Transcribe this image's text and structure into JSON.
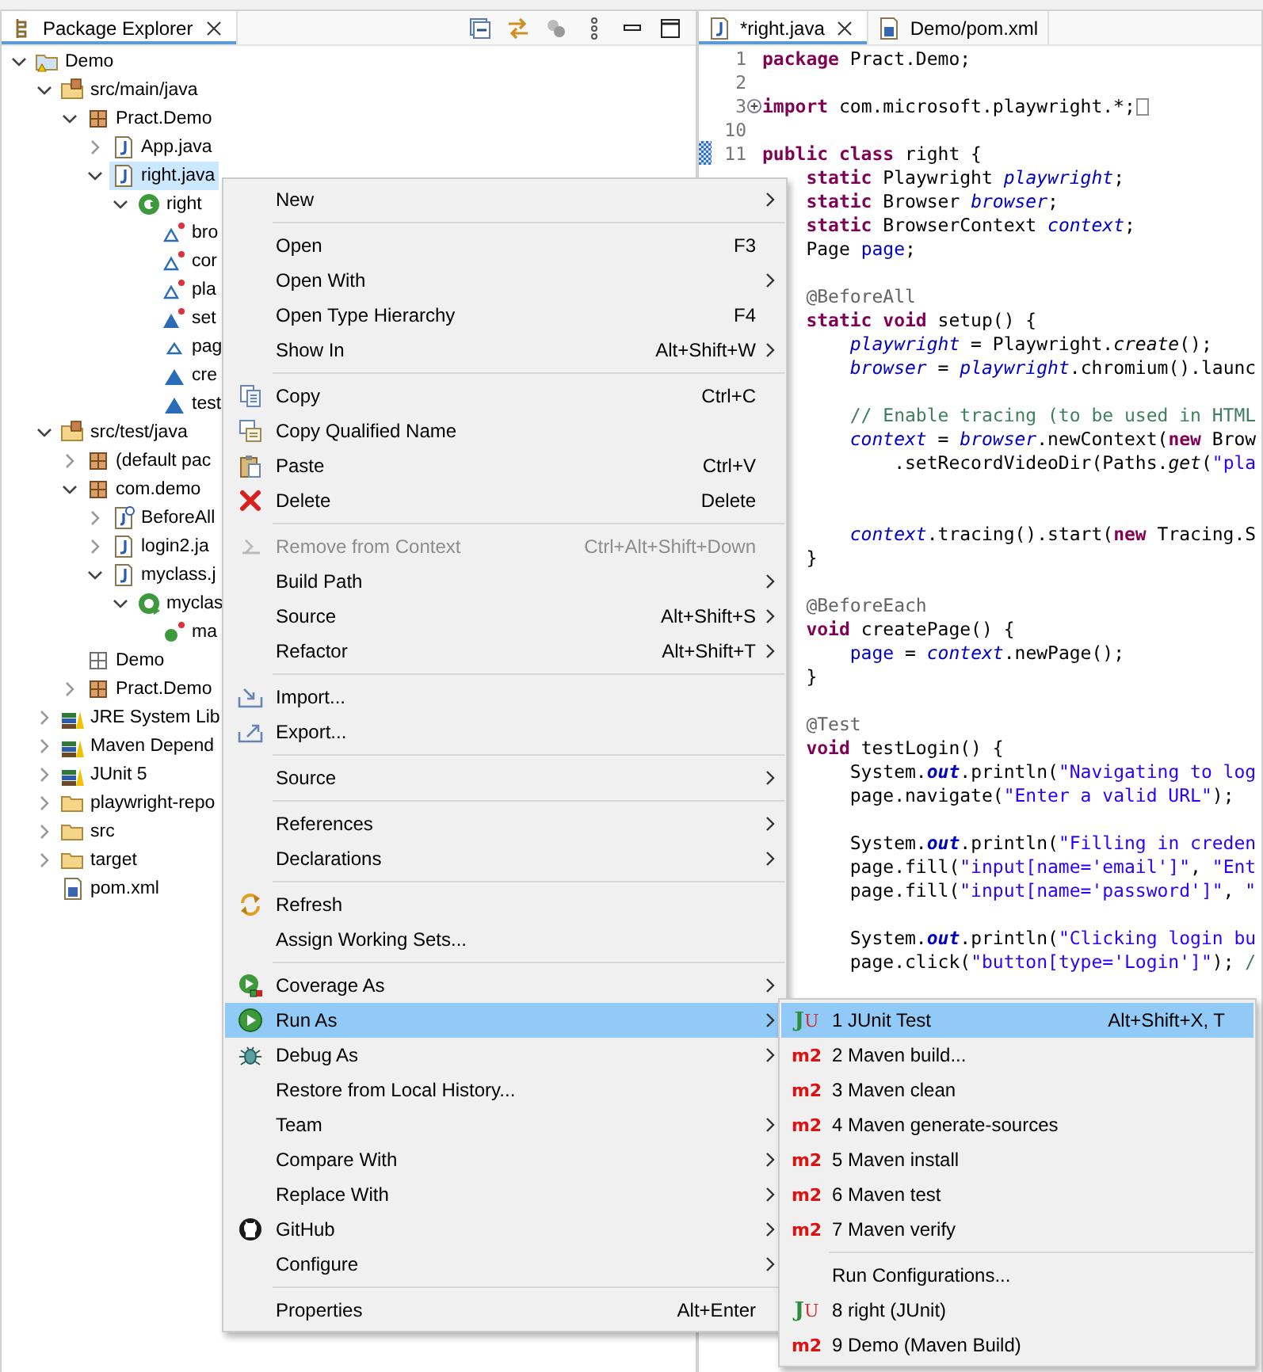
{
  "package_explorer": {
    "title": "Package Explorer",
    "tree": [
      {
        "label": "Demo",
        "kind": "project",
        "expanded": true,
        "selected": false,
        "children": [
          {
            "label": "src/main/java",
            "kind": "source-folder",
            "expanded": true,
            "selected": false,
            "children": [
              {
                "label": "Pract.Demo",
                "kind": "package",
                "expanded": true,
                "selected": false,
                "children": [
                  {
                    "label": "App.java",
                    "kind": "java-file",
                    "expanded": false,
                    "selected": false
                  },
                  {
                    "label": "right.java",
                    "kind": "java-file",
                    "expanded": true,
                    "selected": true,
                    "children": [
                      {
                        "label": "right",
                        "kind": "class",
                        "expanded": true,
                        "selected": false,
                        "children": [
                          {
                            "label": "bro",
                            "kind": "static-field",
                            "selected": false
                          },
                          {
                            "label": "cor",
                            "kind": "static-field",
                            "selected": false
                          },
                          {
                            "label": "pla",
                            "kind": "static-field",
                            "selected": false
                          },
                          {
                            "label": "set",
                            "kind": "static-method",
                            "selected": false
                          },
                          {
                            "label": "pag",
                            "kind": "field",
                            "selected": false
                          },
                          {
                            "label": "cre",
                            "kind": "method",
                            "selected": false
                          },
                          {
                            "label": "test",
                            "kind": "method",
                            "selected": false
                          }
                        ]
                      }
                    ]
                  }
                ]
              }
            ]
          },
          {
            "label": "src/test/java",
            "kind": "source-folder",
            "expanded": true,
            "selected": false,
            "children": [
              {
                "label": "(default pac",
                "kind": "package",
                "expanded": false,
                "selected": false
              },
              {
                "label": "com.demo",
                "kind": "package",
                "expanded": true,
                "selected": false,
                "children": [
                  {
                    "label": "BeforeAll",
                    "kind": "annotation-file",
                    "expanded": false,
                    "selected": false
                  },
                  {
                    "label": "login2.ja",
                    "kind": "java-file",
                    "expanded": false,
                    "selected": false
                  },
                  {
                    "label": "myclass.j",
                    "kind": "java-file",
                    "expanded": true,
                    "selected": false,
                    "children": [
                      {
                        "label": "myclas",
                        "kind": "main-class",
                        "expanded": true,
                        "selected": false,
                        "children": [
                          {
                            "label": "ma",
                            "kind": "main-method",
                            "selected": false
                          }
                        ]
                      }
                    ]
                  }
                ]
              },
              {
                "label": "Demo",
                "kind": "empty-package",
                "selected": false
              },
              {
                "label": "Pract.Demo",
                "kind": "package",
                "expanded": false,
                "selected": false
              }
            ]
          },
          {
            "label": "JRE System Lib",
            "kind": "library",
            "expanded": false,
            "selected": false
          },
          {
            "label": "Maven Depend",
            "kind": "library",
            "expanded": false,
            "selected": false
          },
          {
            "label": "JUnit 5",
            "kind": "library",
            "expanded": false,
            "selected": false
          },
          {
            "label": "playwright-repo",
            "kind": "folder",
            "expanded": false,
            "selected": false
          },
          {
            "label": "src",
            "kind": "folder",
            "expanded": false,
            "selected": false
          },
          {
            "label": "target",
            "kind": "folder",
            "expanded": false,
            "selected": false
          },
          {
            "label": "pom.xml",
            "kind": "xml-file",
            "selected": false
          }
        ]
      }
    ]
  },
  "editor": {
    "tabs": [
      {
        "label": "*right.java",
        "kind": "java-file",
        "selected": true
      },
      {
        "label": "Demo/pom.xml",
        "kind": "xml-file",
        "selected": false
      }
    ],
    "lines": [
      {
        "number": "1",
        "tokens": [
          {
            "kind": "keyword",
            "text": "package"
          },
          {
            "kind": "plain",
            "text": " Pract.Demo;"
          }
        ]
      },
      {
        "number": "2"
      },
      {
        "number": "3",
        "folded": true,
        "tokens": [
          {
            "kind": "keyword",
            "text": "import"
          },
          {
            "kind": "plain",
            "text": " com.microsoft.playwright.*;"
          }
        ]
      },
      {
        "number": "10"
      },
      {
        "number": "11",
        "changed": true,
        "tokens": [
          {
            "kind": "keyword",
            "text": "public class"
          },
          {
            "kind": "plain",
            "text": " right {"
          }
        ]
      },
      {
        "tokens": [
          {
            "kind": "keyword",
            "text": "    static"
          },
          {
            "kind": "plain",
            "text": " Playwright "
          },
          {
            "kind": "field",
            "text": "playwright"
          },
          {
            "kind": "plain",
            "text": ";"
          }
        ]
      },
      {
        "tokens": [
          {
            "kind": "keyword",
            "text": "    static"
          },
          {
            "kind": "plain",
            "text": " Browser "
          },
          {
            "kind": "field",
            "text": "browser"
          },
          {
            "kind": "plain",
            "text": ";"
          }
        ]
      },
      {
        "tokens": [
          {
            "kind": "keyword",
            "text": "    static"
          },
          {
            "kind": "plain",
            "text": " BrowserContext "
          },
          {
            "kind": "field",
            "text": "context"
          },
          {
            "kind": "plain",
            "text": ";"
          }
        ]
      },
      {
        "tokens": [
          {
            "kind": "plain",
            "text": "    Page "
          },
          {
            "kind": "member",
            "text": "page"
          },
          {
            "kind": "plain",
            "text": ";"
          }
        ]
      },
      {
        "kind": "after_blank",
        "tokens": [
          {
            "kind": "annotation",
            "text": "    @BeforeAll"
          }
        ]
      },
      {
        "tokens": [
          {
            "kind": "keyword",
            "text": "    static void"
          },
          {
            "kind": "plain",
            "text": " setup() {"
          }
        ]
      },
      {
        "tokens": [
          {
            "kind": "field",
            "text": "        playwright"
          },
          {
            "kind": "plain",
            "text": " = Playwright."
          },
          {
            "kind": "static_call",
            "text": "create"
          },
          {
            "kind": "plain",
            "text": "();"
          }
        ]
      },
      {
        "tokens": [
          {
            "kind": "field",
            "text": "        browser"
          },
          {
            "kind": "plain",
            "text": " = "
          },
          {
            "kind": "field",
            "text": "playwright"
          },
          {
            "kind": "plain",
            "text": ".chromium().launc"
          }
        ]
      },
      {
        "kind": "after_blank",
        "tokens": [
          {
            "kind": "comment",
            "text": "        // Enable tracing (to be used in HTML"
          }
        ]
      },
      {
        "tokens": [
          {
            "kind": "field",
            "text": "        context"
          },
          {
            "kind": "plain",
            "text": " = "
          },
          {
            "kind": "field",
            "text": "browser"
          },
          {
            "kind": "plain",
            "text": ".newContext("
          },
          {
            "kind": "keyword",
            "text": "new"
          },
          {
            "kind": "plain",
            "text": " Brow"
          }
        ]
      },
      {
        "tokens": [
          {
            "kind": "plain",
            "text": "            .setRecordVideoDir(Paths."
          },
          {
            "kind": "static_call",
            "text": "get"
          },
          {
            "kind": "plain",
            "text": "("
          },
          {
            "kind": "string",
            "text": "\"pla"
          }
        ]
      },
      {
        "kind": "after_two_blanks",
        "tokens": [
          {
            "kind": "field",
            "text": "        context"
          },
          {
            "kind": "plain",
            "text": ".tracing().start("
          },
          {
            "kind": "keyword",
            "text": "new"
          },
          {
            "kind": "plain",
            "text": " Tracing.S"
          }
        ]
      },
      {
        "tokens": [
          {
            "kind": "plain",
            "text": "    }"
          }
        ]
      },
      {
        "kind": "after_blank",
        "tokens": [
          {
            "kind": "annotation",
            "text": "    @BeforeEach"
          }
        ]
      },
      {
        "tokens": [
          {
            "kind": "keyword",
            "text": "    void"
          },
          {
            "kind": "plain",
            "text": " createPage() {"
          }
        ]
      },
      {
        "tokens": [
          {
            "kind": "member",
            "text": "        page"
          },
          {
            "kind": "plain",
            "text": " = "
          },
          {
            "kind": "field",
            "text": "context"
          },
          {
            "kind": "plain",
            "text": ".newPage();"
          }
        ]
      },
      {
        "tokens": [
          {
            "kind": "plain",
            "text": "    }"
          }
        ]
      },
      {
        "kind": "after_blank",
        "tokens": [
          {
            "kind": "annotation",
            "text": "    @Test"
          }
        ]
      },
      {
        "tokens": [
          {
            "kind": "keyword",
            "text": "    void"
          },
          {
            "kind": "plain",
            "text": " testLogin() {"
          }
        ]
      },
      {
        "tokens": [
          {
            "kind": "plain",
            "text": "        System."
          },
          {
            "kind": "static_field",
            "text": "out"
          },
          {
            "kind": "plain",
            "text": ".println("
          },
          {
            "kind": "string",
            "text": "\"Navigating to log"
          }
        ]
      },
      {
        "tokens": [
          {
            "kind": "plain",
            "text": "        page.navigate("
          },
          {
            "kind": "string",
            "text": "\"Enter a valid URL\""
          },
          {
            "kind": "plain",
            "text": ");"
          }
        ]
      },
      {
        "kind": "after_blank",
        "tokens": [
          {
            "kind": "plain",
            "text": "        System."
          },
          {
            "kind": "static_field",
            "text": "out"
          },
          {
            "kind": "plain",
            "text": ".println("
          },
          {
            "kind": "string",
            "text": "\"Filling in creden"
          }
        ]
      },
      {
        "tokens": [
          {
            "kind": "plain",
            "text": "        page.fill("
          },
          {
            "kind": "string",
            "text": "\"input[name='email']\""
          },
          {
            "kind": "plain",
            "text": ", "
          },
          {
            "kind": "string",
            "text": "\"Ent"
          }
        ]
      },
      {
        "tokens": [
          {
            "kind": "plain",
            "text": "        page.fill("
          },
          {
            "kind": "string",
            "text": "\"input[name='password']\""
          },
          {
            "kind": "plain",
            "text": ", "
          },
          {
            "kind": "string",
            "text": "\""
          }
        ]
      },
      {
        "kind": "after_blank",
        "tokens": [
          {
            "kind": "plain",
            "text": "        System."
          },
          {
            "kind": "static_field",
            "text": "out"
          },
          {
            "kind": "plain",
            "text": ".println("
          },
          {
            "kind": "string",
            "text": "\"Clicking login bu"
          }
        ]
      },
      {
        "tokens": [
          {
            "kind": "plain",
            "text": "        page.click("
          },
          {
            "kind": "string",
            "text": "\"button[type='Login']\""
          },
          {
            "kind": "plain",
            "text": "); "
          },
          {
            "kind": "comment",
            "text": "/"
          }
        ]
      }
    ]
  },
  "context_menu": {
    "items": [
      {
        "kind": "item",
        "label": "New",
        "submenu": true,
        "disabled": false,
        "selected": false
      },
      {
        "kind": "separator"
      },
      {
        "kind": "item",
        "label": "Open",
        "shortcut": "F3",
        "submenu": false,
        "disabled": false,
        "selected": false
      },
      {
        "kind": "item",
        "label": "Open With",
        "submenu": true,
        "disabled": false,
        "selected": false
      },
      {
        "kind": "item",
        "label": "Open Type Hierarchy",
        "shortcut": "F4",
        "submenu": false,
        "disabled": false,
        "selected": false
      },
      {
        "kind": "item",
        "label": "Show In",
        "shortcut": "Alt+Shift+W",
        "submenu": true,
        "disabled": false,
        "selected": false
      },
      {
        "kind": "separator"
      },
      {
        "kind": "copy",
        "label": "Copy",
        "shortcut": "Ctrl+C",
        "submenu": false,
        "disabled": false,
        "selected": false
      },
      {
        "kind": "copy-name",
        "label": "Copy Qualified Name",
        "submenu": false,
        "disabled": false,
        "selected": false
      },
      {
        "kind": "paste",
        "label": "Paste",
        "shortcut": "Ctrl+V",
        "submenu": false,
        "disabled": false,
        "selected": false
      },
      {
        "kind": "delete",
        "label": "Delete",
        "shortcut": "Delete",
        "submenu": false,
        "disabled": false,
        "selected": false
      },
      {
        "kind": "separator"
      },
      {
        "kind": "remove",
        "label": "Remove from Context",
        "shortcut": "Ctrl+Alt+Shift+Down",
        "submenu": false,
        "disabled": true,
        "selected": false
      },
      {
        "kind": "item",
        "label": "Build Path",
        "submenu": true,
        "disabled": false,
        "selected": false
      },
      {
        "kind": "item",
        "label": "Source",
        "shortcut": "Alt+Shift+S",
        "submenu": true,
        "disabled": false,
        "selected": false
      },
      {
        "kind": "item",
        "label": "Refactor",
        "shortcut": "Alt+Shift+T",
        "submenu": true,
        "disabled": false,
        "selected": false
      },
      {
        "kind": "separator"
      },
      {
        "kind": "import",
        "label": "Import...",
        "submenu": false,
        "disabled": false,
        "selected": false
      },
      {
        "kind": "export",
        "label": "Export...",
        "submenu": false,
        "disabled": false,
        "selected": false
      },
      {
        "kind": "separator"
      },
      {
        "kind": "item",
        "label": "Source",
        "submenu": true,
        "disabled": false,
        "selected": false
      },
      {
        "kind": "separator"
      },
      {
        "kind": "item",
        "label": "References",
        "submenu": true,
        "disabled": false,
        "selected": false
      },
      {
        "kind": "item",
        "label": "Declarations",
        "submenu": true,
        "disabled": false,
        "selected": false
      },
      {
        "kind": "separator"
      },
      {
        "kind": "refresh",
        "label": "Refresh",
        "submenu": false,
        "disabled": false,
        "selected": false
      },
      {
        "kind": "item",
        "label": "Assign Working Sets...",
        "submenu": false,
        "disabled": false,
        "selected": false
      },
      {
        "kind": "separator"
      },
      {
        "kind": "coverage",
        "label": "Coverage As",
        "submenu": true,
        "disabled": false,
        "selected": false
      },
      {
        "kind": "run",
        "label": "Run As",
        "submenu": true,
        "disabled": false,
        "selected": true
      },
      {
        "kind": "debug",
        "label": "Debug As",
        "submenu": true,
        "disabled": false,
        "selected": false
      },
      {
        "kind": "item",
        "label": "Restore from Local History...",
        "submenu": false,
        "disabled": false,
        "selected": false
      },
      {
        "kind": "item",
        "label": "Team",
        "submenu": true,
        "disabled": false,
        "selected": false
      },
      {
        "kind": "item",
        "label": "Compare With",
        "submenu": true,
        "disabled": false,
        "selected": false
      },
      {
        "kind": "item",
        "label": "Replace With",
        "submenu": true,
        "disabled": false,
        "selected": false
      },
      {
        "kind": "github",
        "label": "GitHub",
        "submenu": true,
        "disabled": false,
        "selected": false
      },
      {
        "kind": "item",
        "label": "Configure",
        "submenu": true,
        "disabled": false,
        "selected": false
      },
      {
        "kind": "separator"
      },
      {
        "kind": "item",
        "label": "Properties",
        "shortcut": "Alt+Enter",
        "submenu": false,
        "disabled": false,
        "selected": false
      }
    ]
  },
  "run_as_submenu": {
    "items": [
      {
        "kind": "junit",
        "badge": "JU",
        "label": "1 JUnit Test",
        "shortcut": "Alt+Shift+X, T",
        "selected": true
      },
      {
        "kind": "maven",
        "badge": "m2",
        "label": "2 Maven build...",
        "selected": false
      },
      {
        "kind": "maven",
        "badge": "m2",
        "label": "3 Maven clean",
        "selected": false
      },
      {
        "kind": "maven",
        "badge": "m2",
        "label": "4 Maven generate-sources",
        "selected": false
      },
      {
        "kind": "maven",
        "badge": "m2",
        "label": "5 Maven install",
        "selected": false
      },
      {
        "kind": "maven",
        "badge": "m2",
        "label": "6 Maven test",
        "selected": false
      },
      {
        "kind": "maven",
        "badge": "m2",
        "label": "7 Maven verify",
        "selected": false
      },
      {
        "kind": "separator"
      },
      {
        "kind": "plain",
        "label": "Run Configurations...",
        "selected": false
      },
      {
        "kind": "junit",
        "badge": "JU",
        "label": "8 right (JUnit)",
        "selected": false
      },
      {
        "kind": "maven",
        "badge": "m2",
        "label": "9 Demo (Maven Build)",
        "selected": false
      }
    ]
  }
}
